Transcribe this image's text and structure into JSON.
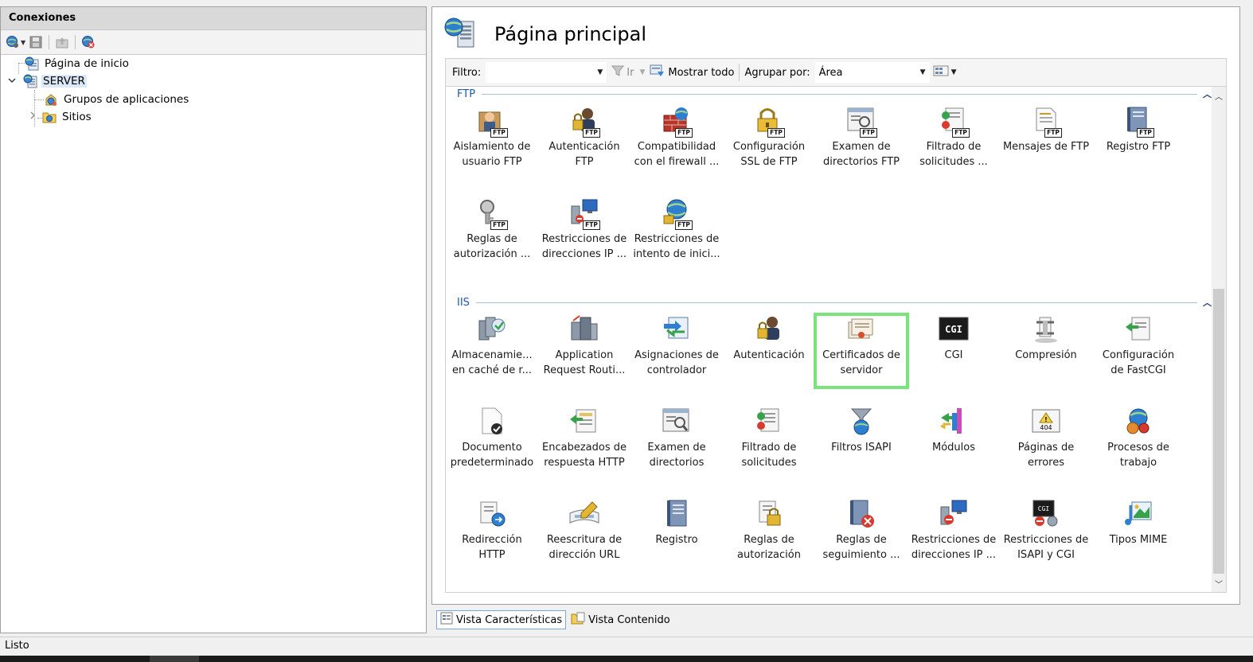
{
  "connections": {
    "header": "Conexiones",
    "toolbar": [
      {
        "icon": "connect-globe-icon",
        "has_dropdown": true
      },
      {
        "icon": "save-icon"
      },
      {
        "icon": "up-level-icon"
      },
      {
        "icon": "disconnect-icon"
      }
    ],
    "tree": [
      {
        "label": "Página de inicio",
        "icon": "start-page-icon"
      },
      {
        "label": "SERVER",
        "icon": "server-icon",
        "selected": true,
        "expanded": true
      },
      {
        "label": "Grupos de aplicaciones",
        "icon": "app-pools-icon"
      },
      {
        "label": "Sitios",
        "icon": "sites-folder-icon",
        "collapsed": true
      }
    ]
  },
  "page": {
    "title": "Página principal",
    "icon": "server-home-icon"
  },
  "filter_bar": {
    "filter_label": "Filtro:",
    "filter_value": "",
    "go_label": "Ir",
    "show_all_label": "Mostrar todo",
    "group_by_label": "Agrupar por:",
    "group_by_value": "Área"
  },
  "groups": {
    "ftp": {
      "name": "FTP",
      "items": [
        {
          "label": "Aislamiento de\nusuario FTP",
          "icon": "ftp-user-isolation-icon"
        },
        {
          "label": "Autenticación\nFTP",
          "icon": "ftp-authentication-icon"
        },
        {
          "label": "Compatibilidad\ncon el firewall ...",
          "icon": "ftp-firewall-icon"
        },
        {
          "label": "Configuración\nSSL de FTP",
          "icon": "ftp-ssl-icon"
        },
        {
          "label": "Examen de\ndirectorios FTP",
          "icon": "ftp-directory-browsing-icon"
        },
        {
          "label": "Filtrado de\nsolicitudes ...",
          "icon": "ftp-request-filtering-icon"
        },
        {
          "label": "Mensajes de FTP",
          "icon": "ftp-messages-icon"
        },
        {
          "label": "Registro FTP",
          "icon": "ftp-logging-icon"
        },
        {
          "label": "Reglas de\nautorización ...",
          "icon": "ftp-authorization-icon"
        },
        {
          "label": "Restricciones de\ndirecciones IP ...",
          "icon": "ftp-ip-restrictions-icon"
        },
        {
          "label": "Restricciones de\nintento de inici...",
          "icon": "ftp-logon-attempt-icon"
        }
      ]
    },
    "iis": {
      "name": "IIS",
      "items": [
        {
          "label": "Almacenamie...\nen caché de r...",
          "icon": "output-caching-icon"
        },
        {
          "label": "Application\nRequest Routi...",
          "icon": "arr-icon"
        },
        {
          "label": "Asignaciones de\ncontrolador",
          "icon": "handler-mappings-icon"
        },
        {
          "label": "Autenticación",
          "icon": "authentication-icon"
        },
        {
          "label": "Certificados de\nservidor",
          "icon": "server-certificates-icon",
          "selected": true
        },
        {
          "label": "CGI",
          "icon": "cgi-icon"
        },
        {
          "label": "Compresión",
          "icon": "compression-icon"
        },
        {
          "label": "Configuración\nde FastCGI",
          "icon": "fastcgi-icon"
        },
        {
          "label": "Documento\npredeterminado",
          "icon": "default-document-icon"
        },
        {
          "label": "Encabezados de\nrespuesta HTTP",
          "icon": "http-headers-icon"
        },
        {
          "label": "Examen de\ndirectorios",
          "icon": "directory-browsing-icon"
        },
        {
          "label": "Filtrado de\nsolicitudes",
          "icon": "request-filtering-icon"
        },
        {
          "label": "Filtros ISAPI",
          "icon": "isapi-filters-icon"
        },
        {
          "label": "Módulos",
          "icon": "modules-icon"
        },
        {
          "label": "Páginas de\nerrores",
          "icon": "error-pages-icon"
        },
        {
          "label": "Procesos de\ntrabajo",
          "icon": "worker-processes-icon"
        },
        {
          "label": "Redirección\nHTTP",
          "icon": "http-redirect-icon"
        },
        {
          "label": "Reescritura de\ndirección URL",
          "icon": "url-rewrite-icon"
        },
        {
          "label": "Registro",
          "icon": "logging-icon"
        },
        {
          "label": "Reglas de\nautorización",
          "icon": "authorization-rules-icon"
        },
        {
          "label": "Reglas de\nseguimiento ...",
          "icon": "failed-request-tracing-icon"
        },
        {
          "label": "Restricciones de\ndirecciones IP ...",
          "icon": "ip-restrictions-icon"
        },
        {
          "label": "Restricciones de\nISAPI y CGI",
          "icon": "isapi-cgi-restrictions-icon"
        },
        {
          "label": "Tipos MIME",
          "icon": "mime-types-icon"
        }
      ]
    }
  },
  "view_tabs": [
    {
      "label": "Vista Características",
      "icon": "features-view-icon",
      "active": true
    },
    {
      "label": "Vista Contenido",
      "icon": "content-view-icon",
      "active": false
    }
  ],
  "status": {
    "text": "Listo"
  },
  "colors": {
    "group_header": "#1e5aa8",
    "selection_outline": "#7be37b",
    "tree_selection": "#dbe8f7"
  }
}
